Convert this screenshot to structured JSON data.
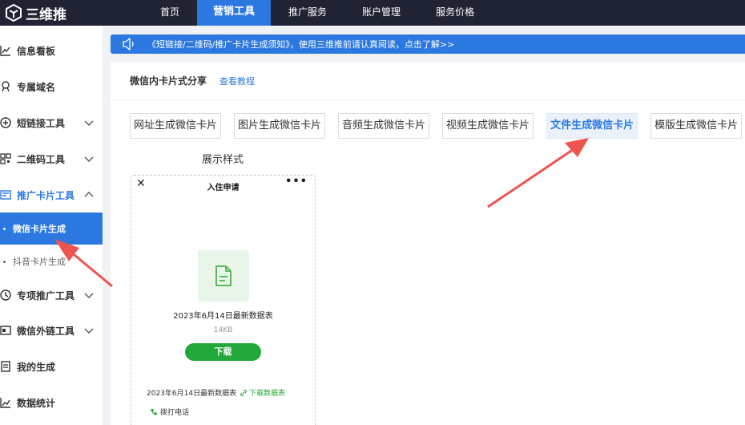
{
  "brand": {
    "name": "三维推"
  },
  "nav": {
    "items": [
      {
        "label": "首页",
        "active": false
      },
      {
        "label": "营销工具",
        "active": true
      },
      {
        "label": "推广服务",
        "active": false
      },
      {
        "label": "账户管理",
        "active": false
      },
      {
        "label": "服务价格",
        "active": false
      }
    ]
  },
  "sidebar": {
    "items": [
      {
        "label": "信息看板",
        "icon": "chart-icon"
      },
      {
        "label": "专属域名",
        "icon": "domain-icon"
      },
      {
        "label": "短链接工具",
        "icon": "link-icon"
      },
      {
        "label": "二维码工具",
        "icon": "qrcode-icon"
      },
      {
        "label": "推广卡片工具",
        "icon": "card-icon"
      },
      {
        "label": "专项推广工具",
        "icon": "promo-icon"
      },
      {
        "label": "微信外链工具",
        "icon": "wechat-link-icon"
      },
      {
        "label": "我的生成",
        "icon": "file-icon"
      },
      {
        "label": "数据统计",
        "icon": "stats-icon"
      }
    ],
    "sub_items": [
      {
        "label": "微信卡片生成",
        "active": true
      },
      {
        "label": "抖音卡片生成",
        "active": false
      }
    ]
  },
  "notice": {
    "text": "《短链接/二维码/推广卡片生成须知》，使用三维推前请认真阅读，点击了解>>"
  },
  "panel": {
    "title": "微信内卡片式分享",
    "tutorial_link": "查看教程"
  },
  "tabs": [
    {
      "label": "网址生成微信卡片",
      "active": false
    },
    {
      "label": "图片生成微信卡片",
      "active": false
    },
    {
      "label": "音频生成微信卡片",
      "active": false
    },
    {
      "label": "视频生成微信卡片",
      "active": false
    },
    {
      "label": "文件生成微信卡片",
      "active": true
    },
    {
      "label": "模版生成微信卡片",
      "active": false
    }
  ],
  "preview": {
    "heading": "展示样式",
    "page_title": "入住申请",
    "close_glyph": "✕",
    "more_glyph": "•••",
    "file_name": "2023年6月14日最新数据表",
    "file_size": "14KB",
    "download_label": "下载",
    "footer_file": "2023年6月14日最新数据表",
    "footer_link": "下载数据表",
    "call_label": "拨打电话"
  },
  "colors": {
    "accent": "#2b79e0",
    "topbar": "#1f2333",
    "green": "#22a73a",
    "arrow": "#ee5450"
  }
}
